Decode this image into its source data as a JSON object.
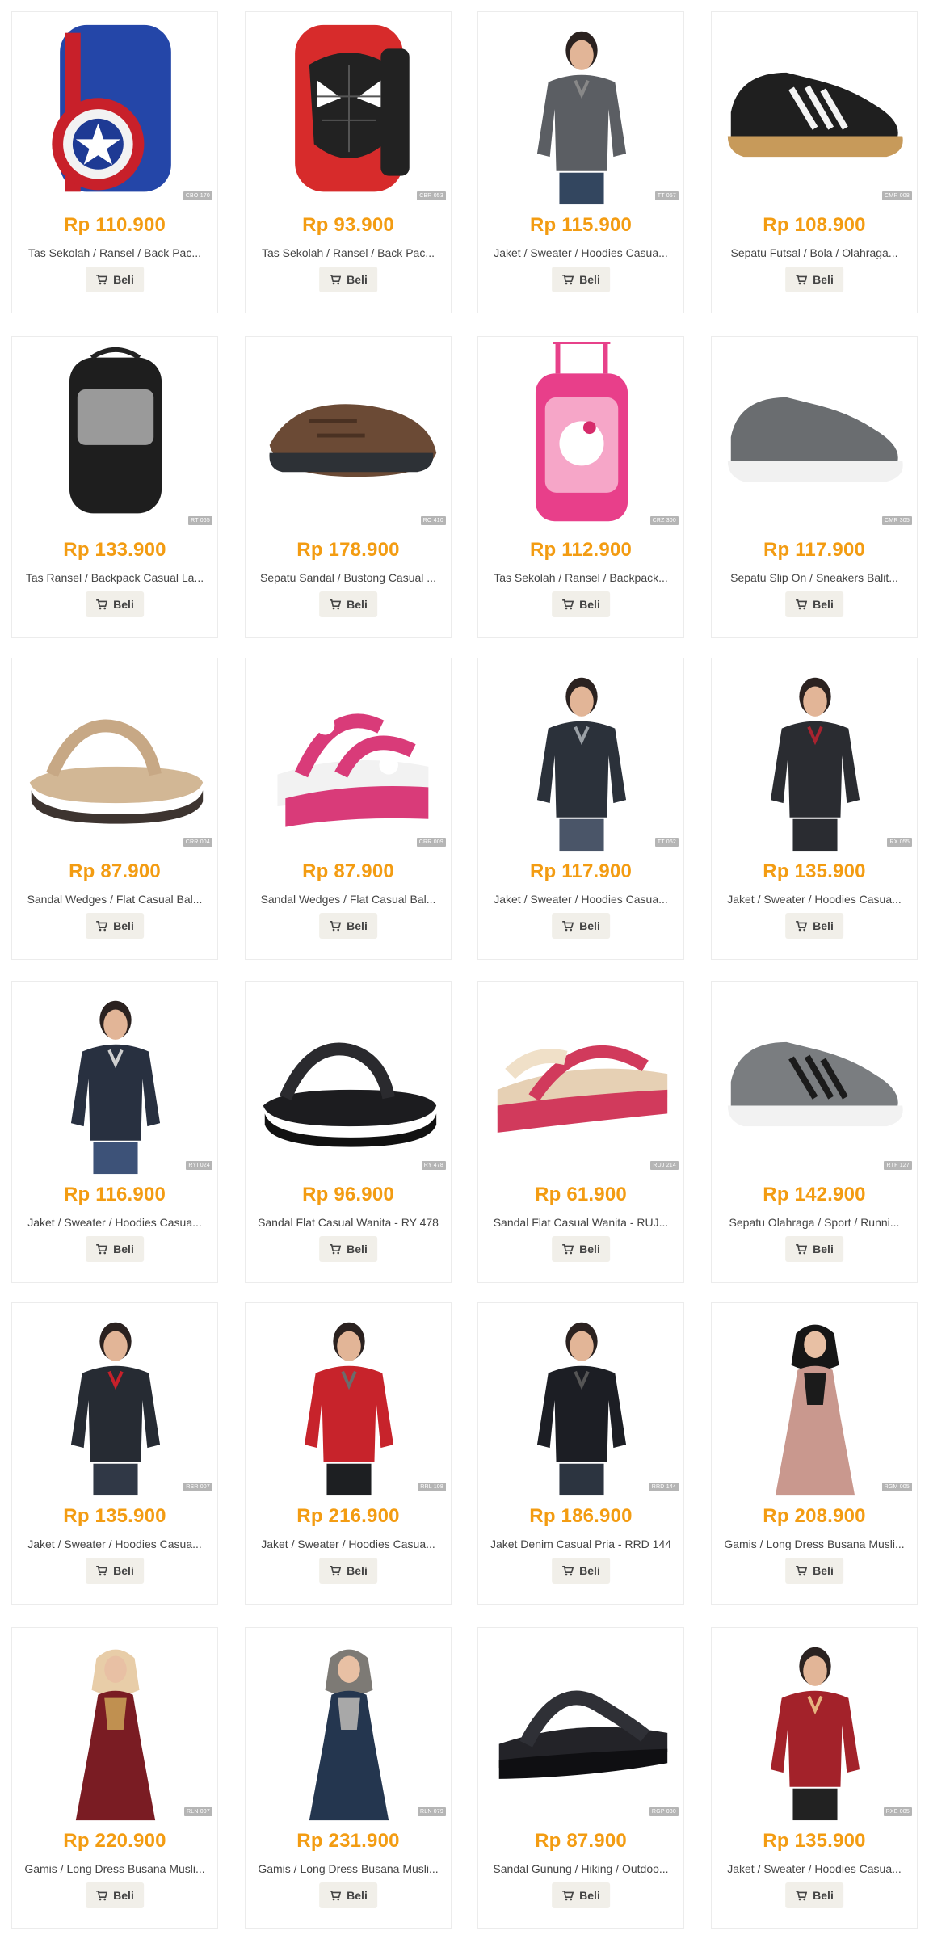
{
  "button_label": "Beli",
  "products": [
    {
      "price": "Rp 110.900",
      "title": "Tas Sekolah / Ransel / Back Pac...",
      "sku": "CBO 170",
      "image": "captain-america-backpack"
    },
    {
      "price": "Rp 93.900",
      "title": "Tas Sekolah / Ransel / Back Pac...",
      "sku": "CBR 053",
      "image": "spiderman-backpack"
    },
    {
      "price": "Rp 115.900",
      "title": "Jaket / Sweater / Hoodies Casua...",
      "sku": "TT 057",
      "image": "grey-jacket-woman"
    },
    {
      "price": "Rp 108.900",
      "title": "Sepatu Futsal / Bola / Olahraga...",
      "sku": "CMR 008",
      "image": "black-futsal-shoe"
    },
    {
      "price": "Rp 133.900",
      "title": "Tas Ransel / Backpack Casual La...",
      "sku": "RT 065",
      "image": "black-grey-backpack"
    },
    {
      "price": "Rp 178.900",
      "title": "Sepatu Sandal / Bustong Casual ...",
      "sku": "RO 410",
      "image": "brown-clog-sandal"
    },
    {
      "price": "Rp 112.900",
      "title": "Tas Sekolah / Ransel / Backpack...",
      "sku": "CRZ 300",
      "image": "pink-trolley-backpack"
    },
    {
      "price": "Rp 117.900",
      "title": "Sepatu Slip On / Sneakers Balit...",
      "sku": "CMR 305",
      "image": "grey-kids-sneaker"
    },
    {
      "price": "Rp 87.900",
      "title": "Sandal Wedges / Flat Casual Bal...",
      "sku": "CRR 004",
      "image": "tan-wedge-sandal"
    },
    {
      "price": "Rp 87.900",
      "title": "Sandal Wedges / Flat Casual Bal...",
      "sku": "CRR 009",
      "image": "pink-wedge-sandal"
    },
    {
      "price": "Rp 117.900",
      "title": "Jaket / Sweater / Hoodies Casua...",
      "sku": "TT 062",
      "image": "man-black-jacket"
    },
    {
      "price": "Rp 135.900",
      "title": "Jaket / Sweater / Hoodies Casua...",
      "sku": "RX 055",
      "image": "woman-red-black-jacket"
    },
    {
      "price": "Rp 116.900",
      "title": "Jaket / Sweater / Hoodies Casua...",
      "sku": "RYI 024",
      "image": "woman-navy-jacket"
    },
    {
      "price": "Rp 96.900",
      "title": "Sandal Flat Casual Wanita - RY 478",
      "sku": "RY 478",
      "image": "black-flat-sandal"
    },
    {
      "price": "Rp 61.900",
      "title": "Sandal Flat Casual Wanita - RUJ...",
      "sku": "RUJ 214",
      "image": "pink-flip-flop"
    },
    {
      "price": "Rp 142.900",
      "title": "Sepatu Olahraga / Sport / Runni...",
      "sku": "RTF 127",
      "image": "grey-running-shoe"
    },
    {
      "price": "Rp 135.900",
      "title": "Jaket / Sweater / Hoodies Casua...",
      "sku": "RSR 007",
      "image": "man-grey-red-jacket"
    },
    {
      "price": "Rp 216.900",
      "title": "Jaket / Sweater / Hoodies Casua...",
      "sku": "RRL 108",
      "image": "man-red-black-jacket"
    },
    {
      "price": "Rp 186.900",
      "title": "Jaket Denim Casual Pria - RRD 144",
      "sku": "RRD 144",
      "image": "man-black-denim-jacket"
    },
    {
      "price": "Rp 208.900",
      "title": "Gamis / Long Dress Busana Musli...",
      "sku": "RGM 005",
      "image": "pink-black-gamis"
    },
    {
      "price": "Rp 220.900",
      "title": "Gamis / Long Dress Busana Musli...",
      "sku": "RLN 007",
      "image": "maroon-gamis"
    },
    {
      "price": "Rp 231.900",
      "title": "Gamis / Long Dress Busana Musli...",
      "sku": "RLN 079",
      "image": "navy-gamis"
    },
    {
      "price": "Rp 87.900",
      "title": "Sandal Gunung / Hiking / Outdoo...",
      "sku": "RGP 030",
      "image": "black-hiking-sandal"
    },
    {
      "price": "Rp 135.900",
      "title": "Jaket / Sweater / Hoodies Casua...",
      "sku": "RXE 005",
      "image": "woman-red-jacket"
    }
  ]
}
